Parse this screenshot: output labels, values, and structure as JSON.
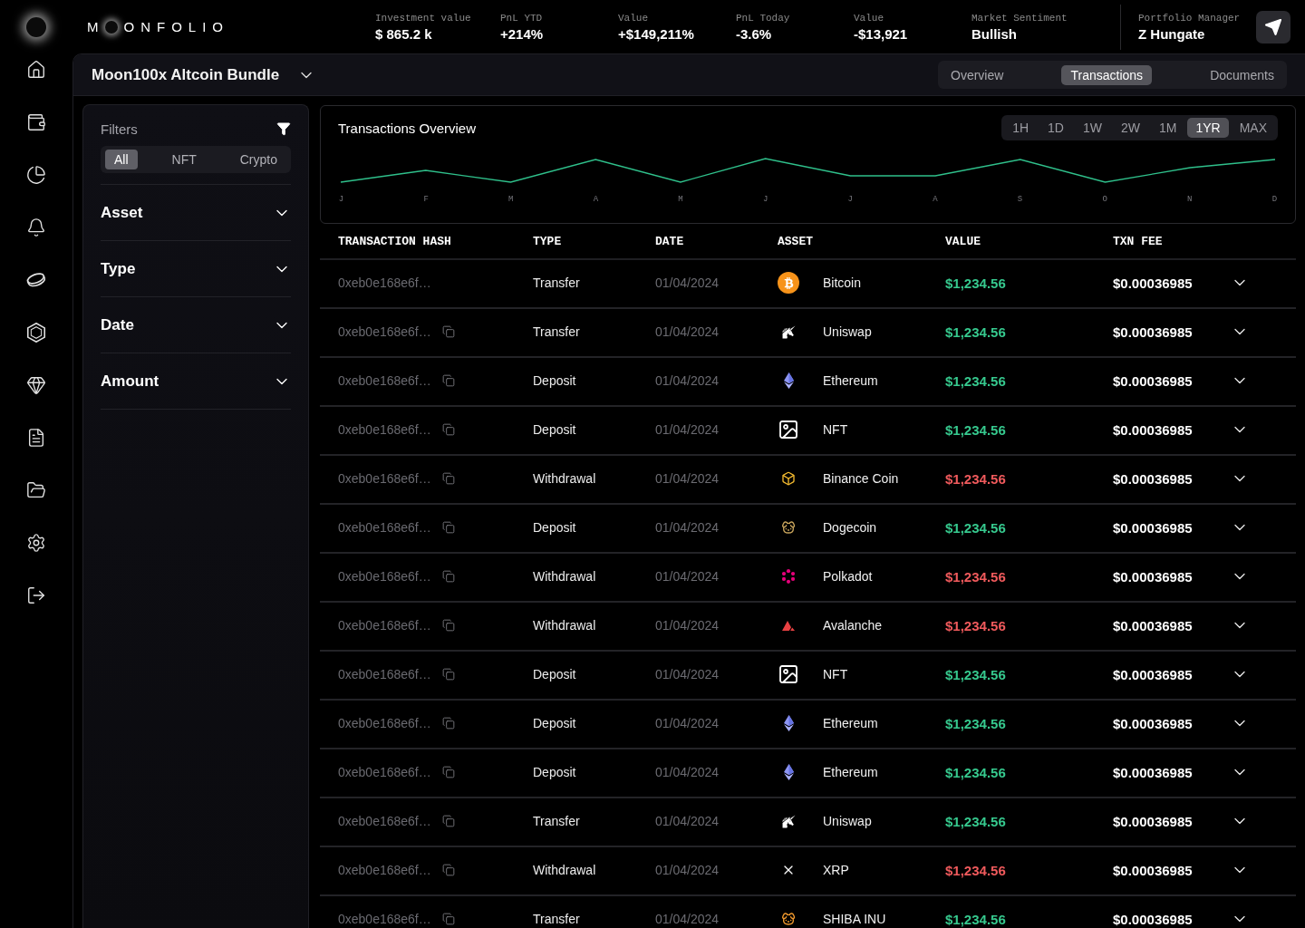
{
  "brand": {
    "lead": "M",
    "rest": "ONFOLIO"
  },
  "stats": [
    {
      "label": "Investment value",
      "value": "$ 865.2 k"
    },
    {
      "label": "PnL YTD",
      "value": "+214%"
    },
    {
      "label": "Value",
      "value": "+$149,211%"
    },
    {
      "label": "PnL Today",
      "value": "-3.6%"
    },
    {
      "label": "Value",
      "value": "-$13,921"
    },
    {
      "label": "Market Sentiment",
      "value": "Bullish"
    }
  ],
  "manager": {
    "label": "Portfolio Manager",
    "value": "Z Hungate"
  },
  "portfolio": {
    "title": "Moon100x Altcoin Bundle"
  },
  "view_tabs": [
    {
      "label": "Overview",
      "selected": false
    },
    {
      "label": "Transactions",
      "selected": true
    },
    {
      "label": "Documents",
      "selected": false
    }
  ],
  "filters": {
    "title": "Filters",
    "segments": [
      {
        "label": "All",
        "selected": true
      },
      {
        "label": "NFT",
        "selected": false
      },
      {
        "label": "Crypto",
        "selected": false
      }
    ],
    "sections": [
      {
        "label": "Asset",
        "expanded": false
      },
      {
        "label": "Type",
        "expanded": false
      },
      {
        "label": "Date",
        "expanded": false
      },
      {
        "label": "Amount",
        "expanded": false
      }
    ]
  },
  "chart": {
    "title": "Transactions Overview",
    "ranges": [
      {
        "label": "1H",
        "selected": false
      },
      {
        "label": "1D",
        "selected": false
      },
      {
        "label": "1W",
        "selected": false
      },
      {
        "label": "2W",
        "selected": false
      },
      {
        "label": "1M",
        "selected": false
      },
      {
        "label": "1YR",
        "selected": true
      },
      {
        "label": "MAX",
        "selected": false
      }
    ],
    "months": [
      "J",
      "F",
      "M",
      "A",
      "M",
      "J",
      "J",
      "A",
      "S",
      "O",
      "N",
      "D"
    ]
  },
  "table": {
    "columns": [
      "TRANSACTION HASH",
      "TYPE",
      "DATE",
      "ASSET",
      "VALUE",
      "TXN FEE"
    ],
    "rows": [
      {
        "hash": "0xeb0e168e6f…",
        "copy_icon": false,
        "type": "Transfer",
        "date": "01/04/2024",
        "asset": {
          "kind": "bitcoin",
          "name": "Bitcoin"
        },
        "value": "$1,234.56",
        "negative": false,
        "fee": "$0.00036985",
        "expanded": false
      },
      {
        "hash": "0xeb0e168e6f…",
        "copy_icon": true,
        "type": "Transfer",
        "date": "01/04/2024",
        "asset": {
          "kind": "uniswap",
          "name": "Uniswap"
        },
        "value": "$1,234.56",
        "negative": false,
        "fee": "$0.00036985",
        "expanded": false
      },
      {
        "hash": "0xeb0e168e6f…",
        "copy_icon": true,
        "type": "Deposit",
        "date": "01/04/2024",
        "asset": {
          "kind": "ethereum",
          "name": "Ethereum"
        },
        "value": "$1,234.56",
        "negative": false,
        "fee": "$0.00036985",
        "expanded": false
      },
      {
        "hash": "0xeb0e168e6f…",
        "copy_icon": true,
        "type": "Deposit",
        "date": "01/04/2024",
        "asset": {
          "kind": "nft",
          "name": "NFT"
        },
        "value": "$1,234.56",
        "negative": false,
        "fee": "$0.00036985",
        "expanded": false
      },
      {
        "hash": "0xeb0e168e6f…",
        "copy_icon": true,
        "type": "Withdrawal",
        "date": "01/04/2024",
        "asset": {
          "kind": "binance",
          "name": "Binance Coin"
        },
        "value": "$1,234.56",
        "negative": true,
        "fee": "$0.00036985",
        "expanded": false
      },
      {
        "hash": "0xeb0e168e6f…",
        "copy_icon": true,
        "type": "Deposit",
        "date": "01/04/2024",
        "asset": {
          "kind": "dogecoin",
          "name": "Dogecoin"
        },
        "value": "$1,234.56",
        "negative": false,
        "fee": "$0.00036985",
        "expanded": false
      },
      {
        "hash": "0xeb0e168e6f…",
        "copy_icon": true,
        "type": "Withdrawal",
        "date": "01/04/2024",
        "asset": {
          "kind": "polkadot",
          "name": "Polkadot"
        },
        "value": "$1,234.56",
        "negative": true,
        "fee": "$0.00036985",
        "expanded": false
      },
      {
        "hash": "0xeb0e168e6f…",
        "copy_icon": true,
        "type": "Withdrawal",
        "date": "01/04/2024",
        "asset": {
          "kind": "avalanche",
          "name": "Avalanche"
        },
        "value": "$1,234.56",
        "negative": true,
        "fee": "$0.00036985",
        "expanded": false
      },
      {
        "hash": "0xeb0e168e6f…",
        "copy_icon": true,
        "type": "Deposit",
        "date": "01/04/2024",
        "asset": {
          "kind": "nft",
          "name": "NFT"
        },
        "value": "$1,234.56",
        "negative": false,
        "fee": "$0.00036985",
        "expanded": false
      },
      {
        "hash": "0xeb0e168e6f…",
        "copy_icon": true,
        "type": "Deposit",
        "date": "01/04/2024",
        "asset": {
          "kind": "ethereum",
          "name": "Ethereum"
        },
        "value": "$1,234.56",
        "negative": false,
        "fee": "$0.00036985",
        "expanded": false
      },
      {
        "hash": "0xeb0e168e6f…",
        "copy_icon": true,
        "type": "Deposit",
        "date": "01/04/2024",
        "asset": {
          "kind": "ethereum",
          "name": "Ethereum"
        },
        "value": "$1,234.56",
        "negative": false,
        "fee": "$0.00036985",
        "expanded": false
      },
      {
        "hash": "0xeb0e168e6f…",
        "copy_icon": true,
        "type": "Transfer",
        "date": "01/04/2024",
        "asset": {
          "kind": "uniswap",
          "name": "Uniswap"
        },
        "value": "$1,234.56",
        "negative": false,
        "fee": "$0.00036985",
        "expanded": false
      },
      {
        "hash": "0xeb0e168e6f…",
        "copy_icon": true,
        "type": "Withdrawal",
        "date": "01/04/2024",
        "asset": {
          "kind": "xrp",
          "name": "XRP"
        },
        "value": "$1,234.56",
        "negative": true,
        "fee": "$0.00036985",
        "expanded": false
      },
      {
        "hash": "0xeb0e168e6f…",
        "copy_icon": true,
        "type": "Transfer",
        "date": "01/04/2024",
        "asset": {
          "kind": "shiba",
          "name": "SHIBA INU"
        },
        "value": "$1,234.56",
        "negative": false,
        "fee": "$0.00036985",
        "expanded": false
      }
    ]
  }
}
